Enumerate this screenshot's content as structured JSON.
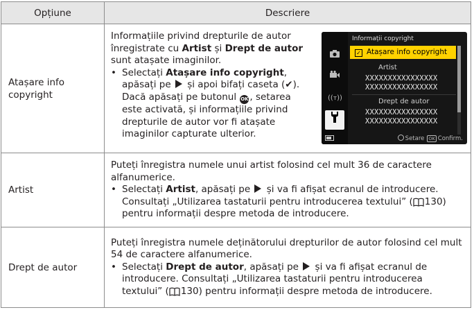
{
  "header": {
    "col1": "Opțiune",
    "col2": "Descriere"
  },
  "rows": [
    {
      "option": "Atașare info copyright",
      "intro_a": "Informațiile privind drepturile de autor înregistrate cu ",
      "intro_b1": "Artist",
      "intro_and": " și ",
      "intro_b2": "Drept de autor",
      "intro_c": " sunt atașate imaginilor.",
      "bullet_pre": "Selectați ",
      "bullet_bold": "Atașare info copyright",
      "bullet_mid": ", apăsați pe ",
      "bullet_mid2": " și apoi bifați caseta (",
      "bullet_check": "✔",
      "bullet_mid3": "). Dacă apăsați pe butonul ",
      "bullet_ok": "OK",
      "bullet_end": ", setarea este activată, și informațiile privind drepturile de autor vor fi atașate imaginilor capturate ulterior."
    },
    {
      "option": "Artist",
      "p1": "Puteți înregistra numele unui artist folosind cel mult 36 de caractere alfanumerice.",
      "bullet_pre": "Selectați ",
      "bullet_bold": "Artist",
      "bullet_mid": ", apăsați pe ",
      "bullet_end": " și va fi afișat ecranul de introducere. Consultați „Utilizarea tastaturii pentru introducerea textului” (",
      "page": "130",
      "bullet_tail": ") pentru informații despre metoda de introducere."
    },
    {
      "option": "Drept de autor",
      "p1": "Puteți înregistra numele deținătorului drepturilor de autor folosind cel mult 54 de caractere alfanumerice.",
      "bullet_pre": "Selectați ",
      "bullet_bold": "Drept de autor",
      "bullet_mid": ", apăsați pe ",
      "bullet_end": " și va fi afișat ecranul de introducere. Consultați „Utilizarea tastaturii pentru introducerea textului” (",
      "page": "130",
      "bullet_tail": ") pentru informații despre metoda de introducere."
    }
  ],
  "camera": {
    "title": "Informații copyright",
    "item_checked": "Atașare info copyright",
    "checkbox_mark": "☑",
    "label_artist": "Artist",
    "artist_line1": "XXXXXXXXXXXXXXXX",
    "artist_line2": "XXXXXXXXXXXXXXXX",
    "label_copyright": "Drept de autor",
    "copyright_line1": "XXXXXXXXXXXXXXXX",
    "copyright_line2": "XXXXXXXXXXXXXXXX",
    "footer_set": "Setare",
    "footer_ok_key": "OK",
    "footer_confirm": "Confirm.",
    "side_icons": [
      "camera-icon",
      "movie-icon",
      "wireless-icon",
      "wrench-icon"
    ],
    "highlight_color": "#ffd200"
  }
}
